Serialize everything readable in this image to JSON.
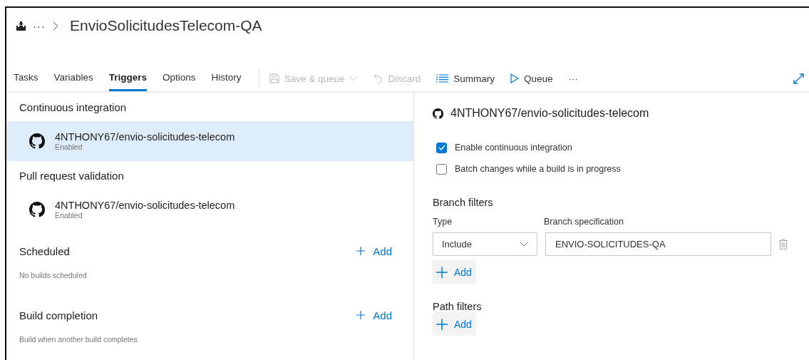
{
  "breadcrumb": {
    "ellipsis": "···",
    "title": "EnvioSolicitudesTelecom-QA"
  },
  "tabs": [
    {
      "label": "Tasks",
      "selected": false
    },
    {
      "label": "Variables",
      "selected": false
    },
    {
      "label": "Triggers",
      "selected": true
    },
    {
      "label": "Options",
      "selected": false
    },
    {
      "label": "History",
      "selected": false
    }
  ],
  "actions": [
    {
      "kind": "save",
      "label": "Save & queue",
      "disabled": true
    },
    {
      "kind": "discard",
      "label": "Discard",
      "disabled": true
    },
    {
      "kind": "summary",
      "label": "Summary",
      "disabled": false
    },
    {
      "kind": "queue",
      "label": "Queue",
      "disabled": false
    },
    {
      "kind": "more",
      "label": "···",
      "disabled": false
    }
  ],
  "sections": [
    {
      "kind": "repos",
      "heading": "Continuous integration",
      "items": [
        {
          "name": "4NTHONY67/envio-solicitudes-telecom",
          "status": "Enabled",
          "selected": true
        }
      ]
    },
    {
      "kind": "repos",
      "heading": "Pull request validation",
      "items": [
        {
          "name": "4NTHONY67/envio-solicitudes-telecom",
          "status": "Enabled",
          "selected": false
        }
      ]
    },
    {
      "kind": "add",
      "heading": "Scheduled",
      "add_label": "Add",
      "note": "No builds scheduled"
    },
    {
      "kind": "add",
      "heading": "Build completion",
      "add_label": "Add",
      "note": "Build when another build completes"
    }
  ],
  "detail": {
    "repo": "4NTHONY67/envio-solicitudes-telecom",
    "checkboxes": [
      {
        "label": "Enable continuous integration",
        "checked": true
      },
      {
        "label": "Batch changes while a build is in progress",
        "checked": false
      }
    ],
    "branch_filters": {
      "heading": "Branch filters",
      "type_label": "Type",
      "spec_label": "Branch specification",
      "type_value": "Include",
      "spec_value": "ENVIO-SOLICITUDES-QA",
      "add_label": "Add"
    },
    "path_filters": {
      "heading": "Path filters",
      "add_label": "Add"
    }
  }
}
